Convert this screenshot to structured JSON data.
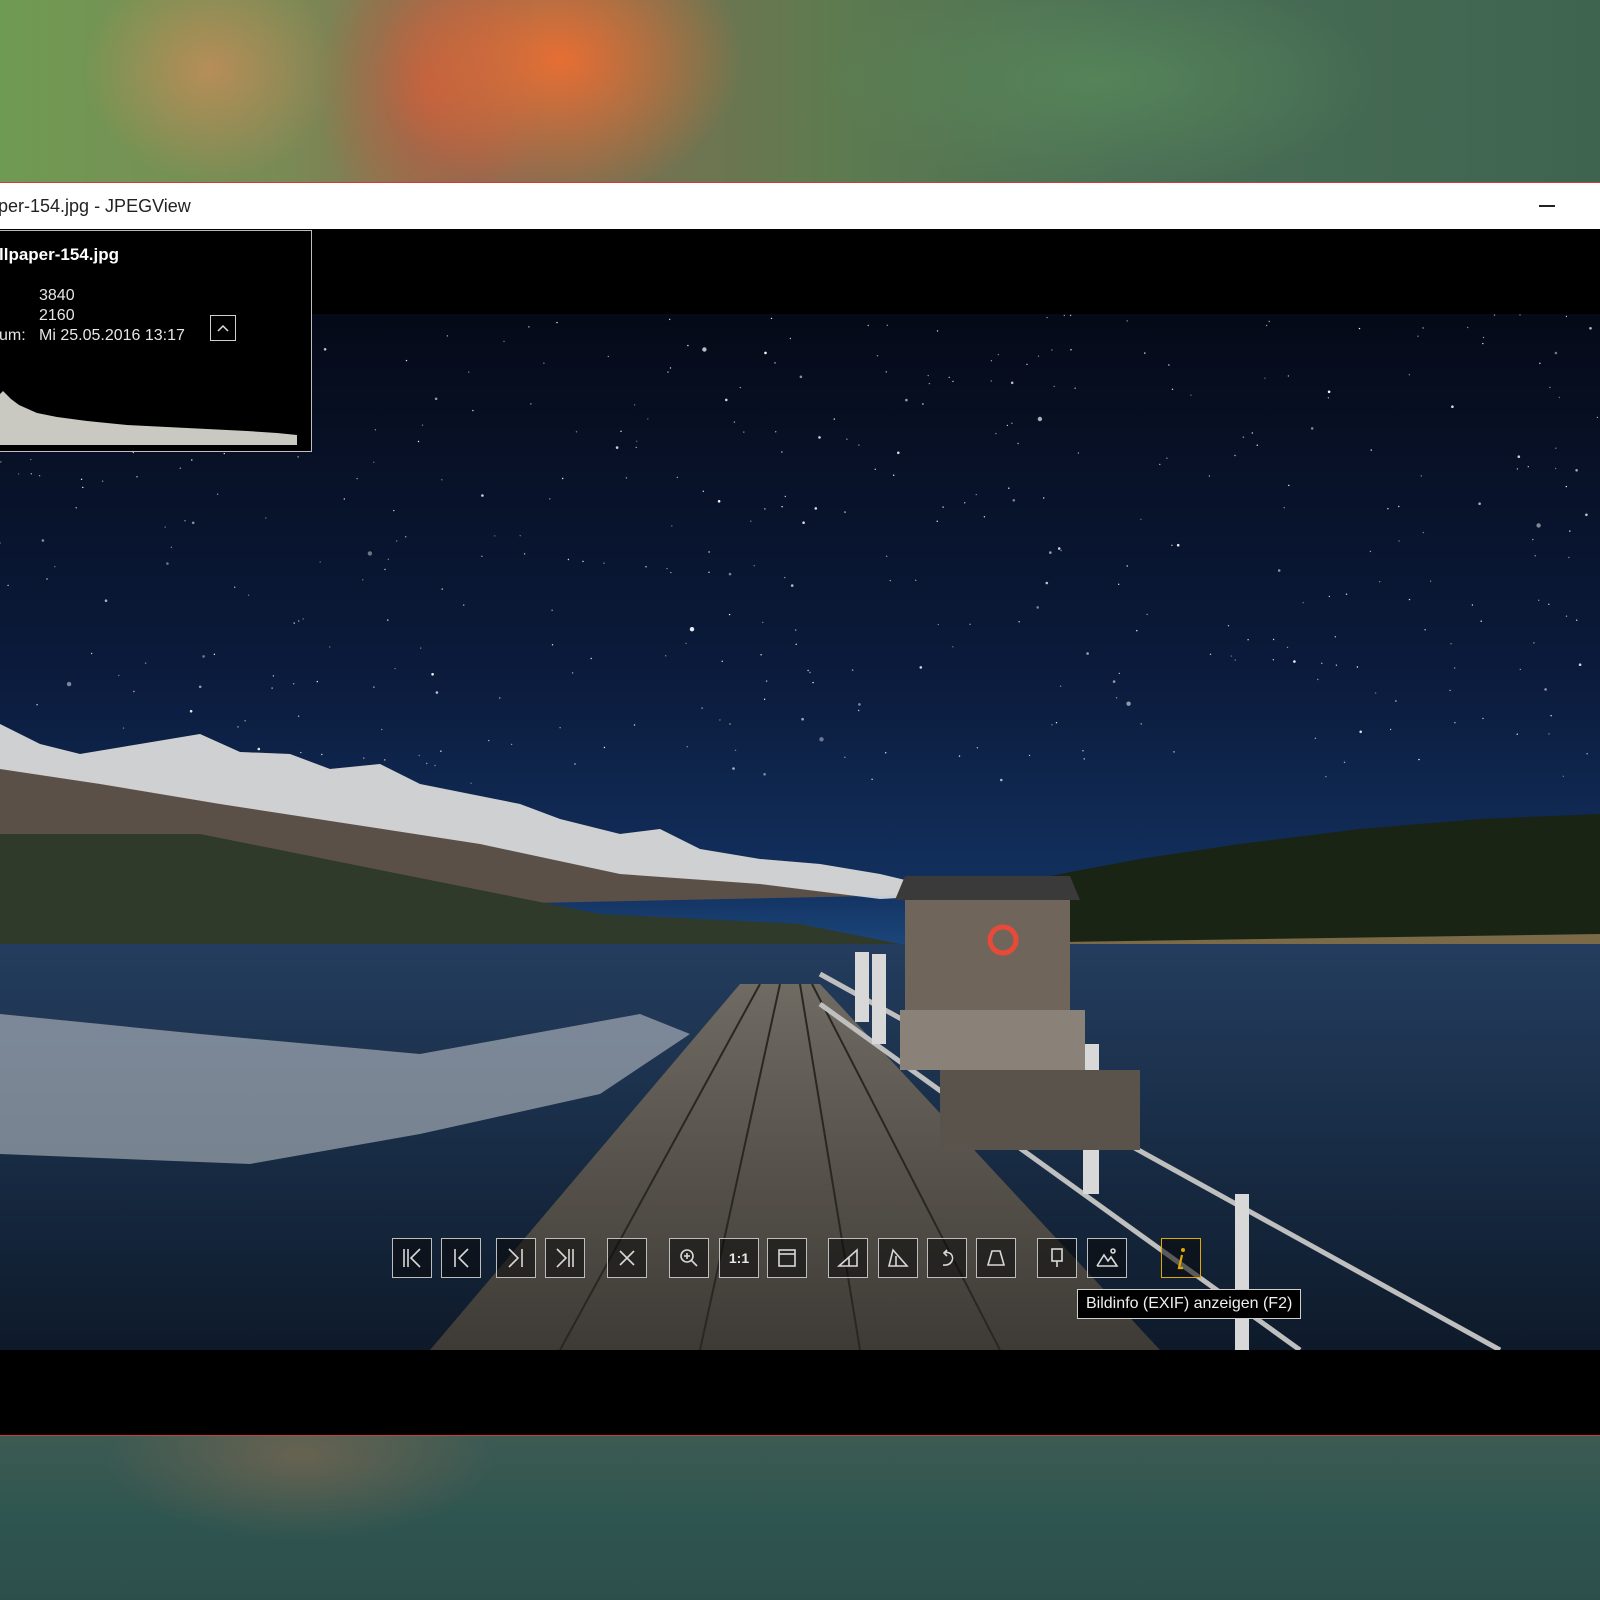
{
  "window": {
    "title": "per-154.jpg - JPEGView"
  },
  "info_panel": {
    "filename": "llpaper-154.jpg",
    "rows": [
      {
        "label": "",
        "value": "3840"
      },
      {
        "label": "",
        "value": "2160"
      },
      {
        "label": "um:",
        "value": "Mi 25.05.2016 13:17"
      }
    ]
  },
  "toolbar": {
    "buttons": [
      {
        "name": "first-image-button",
        "icon": "first-icon"
      },
      {
        "name": "previous-image-button",
        "icon": "previous-icon"
      },
      {
        "name": "next-image-button",
        "icon": "next-icon"
      },
      {
        "name": "last-image-button",
        "icon": "last-icon"
      },
      {
        "name": "delete-button",
        "icon": "close-icon"
      },
      {
        "name": "zoom-button",
        "icon": "zoom-icon"
      },
      {
        "name": "actual-size-button",
        "label": "1:1"
      },
      {
        "name": "fit-window-button",
        "icon": "window-icon"
      },
      {
        "name": "rotate-left-button",
        "icon": "triangle-left-icon"
      },
      {
        "name": "rotate-right-button",
        "icon": "triangle-right-icon"
      },
      {
        "name": "rotate-button",
        "icon": "rotate-icon"
      },
      {
        "name": "perspective-button",
        "icon": "trapezoid-icon"
      },
      {
        "name": "keep-params-button",
        "icon": "pin-icon"
      },
      {
        "name": "landscape-button",
        "icon": "landscape-icon"
      },
      {
        "name": "image-info-button",
        "icon": "info-icon",
        "active": true
      }
    ],
    "tooltip": "Bildinfo (EXIF) anzeigen (F2)"
  },
  "colors": {
    "accent_active": "#e0a800",
    "window_border": "#d23a3a"
  }
}
